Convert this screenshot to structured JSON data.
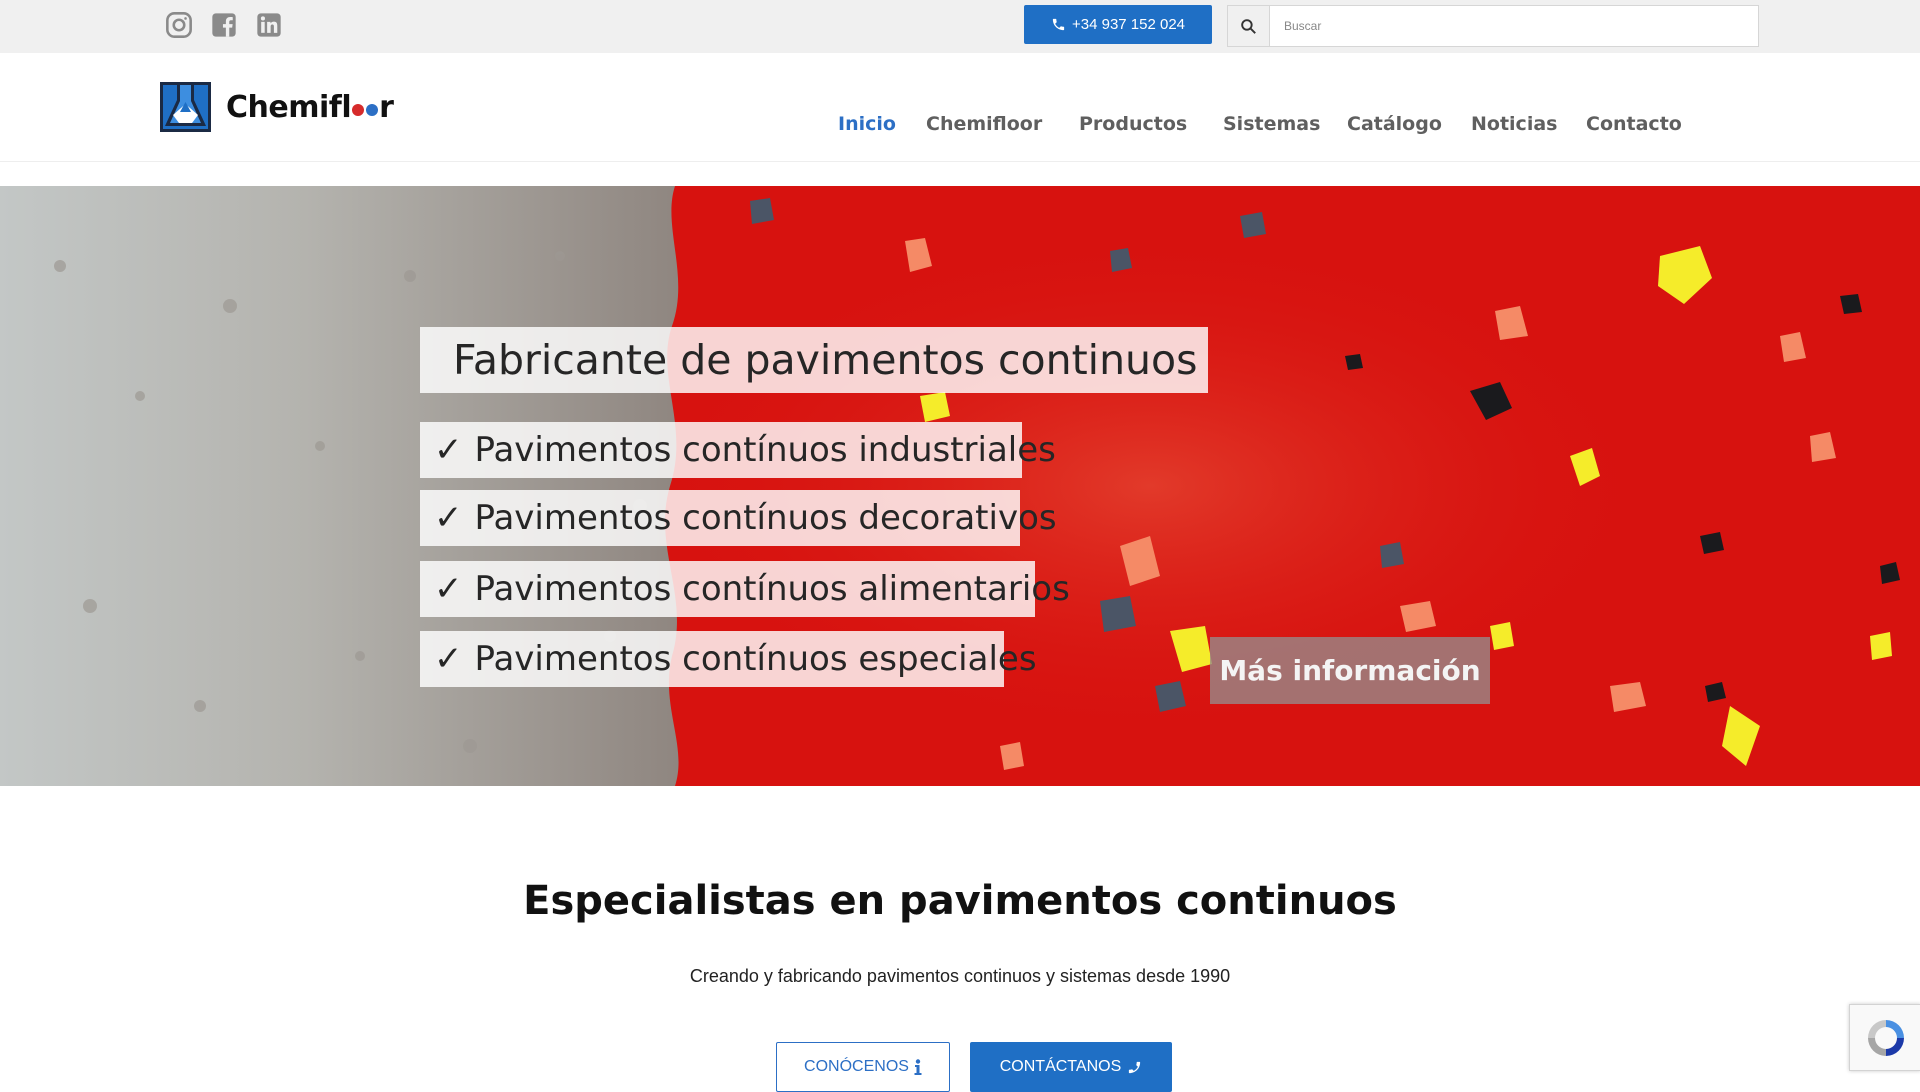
{
  "topbar": {
    "social": [
      "instagram-icon",
      "facebook-icon",
      "linkedin-icon"
    ],
    "phone": {
      "icon": "phone-icon",
      "label": "+34 937 152 024"
    },
    "search": {
      "icon": "search-icon",
      "placeholder": "Buscar",
      "value": ""
    }
  },
  "header": {
    "logo_text_pre": "Chemifl",
    "logo_text_post": "r",
    "nav": [
      {
        "label": "Inicio",
        "active": true
      },
      {
        "label": "Chemifloor"
      },
      {
        "label": "Productos"
      },
      {
        "label": "Sistemas"
      },
      {
        "label": "Catálogo"
      },
      {
        "label": "Noticias"
      },
      {
        "label": "Contacto"
      }
    ]
  },
  "hero": {
    "title": "Fabricante de pavimentos continuos",
    "items": [
      "Pavimentos contínuos industriales",
      "Pavimentos contínuos decorativos",
      "Pavimentos contínuos alimentarios",
      "Pavimentos contínuos especiales"
    ],
    "check": "✓",
    "button": "Más información"
  },
  "intro": {
    "title": "Especialistas en pavimentos continuos",
    "subtitle": "Creando y fabricando pavimentos continuos y sistemas desde 1990",
    "btn_about": "CONÓCENOS",
    "btn_contact": "CONTÁCTANOS"
  },
  "colors": {
    "accent": "#1f6fc5",
    "nav_active": "#2c6fc5",
    "hero_red": "#d7120f",
    "logo_dot_red": "#d62b2b",
    "logo_dot_blue": "#2c6fc5"
  }
}
